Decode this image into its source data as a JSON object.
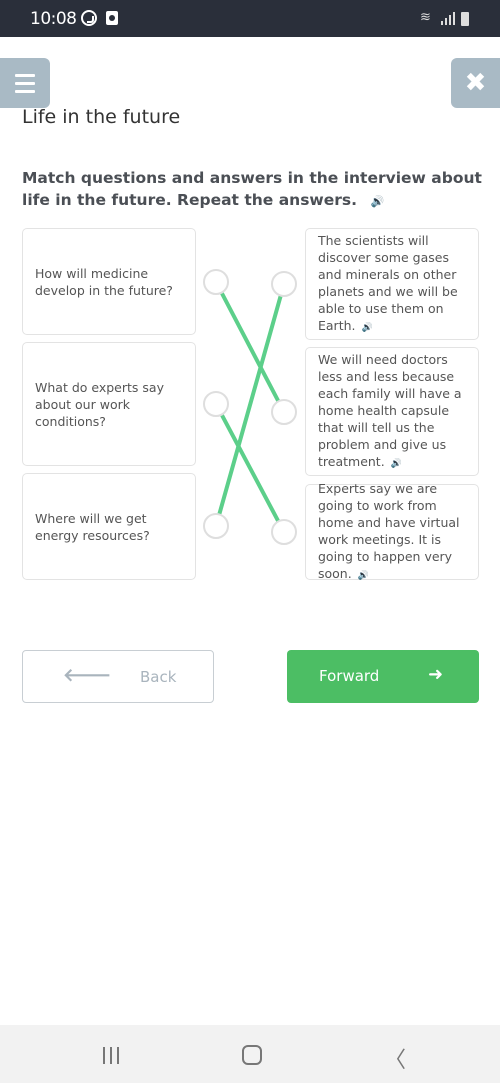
{
  "status_bar": {
    "time": "10:08",
    "icons": [
      "whatsapp-icon",
      "camera-notification-icon",
      "wifi-icon",
      "signal-icon",
      "battery-icon"
    ]
  },
  "header": {
    "menu_icon": "hamburger-menu-icon",
    "close_icon": "close-icon",
    "close_glyph": "✖",
    "title": "Life in the future"
  },
  "exercise": {
    "instruction": "Match questions and answers in the interview about life in the future. Repeat the answers.",
    "speaker_glyph": "🔊",
    "questions": [
      {
        "text": "How will medicine develop in the future?"
      },
      {
        "text": "What do experts say about our work conditions?"
      },
      {
        "text": "Where will we get energy resources?"
      }
    ],
    "answers": [
      {
        "text": "The scientists will discover some gases and minerals on other planets and we will be able to use them on Earth."
      },
      {
        "text": "We will need doctors less and less because each family will have a home health capsule that will tell us the problem and give us treatment."
      },
      {
        "text": "Experts say we are going to work from home and have virtual work meetings. It is going to happen very soon."
      }
    ],
    "connections": [
      {
        "question": 0,
        "answer": 1
      },
      {
        "question": 1,
        "answer": 2
      },
      {
        "question": 2,
        "answer": 0
      }
    ],
    "line_color": "#5ccf8a"
  },
  "navigation": {
    "back_label": "Back",
    "back_arrow": "🡐",
    "forward_label": "Forward",
    "forward_arrow": "➜"
  },
  "system_nav": {
    "recents": "recents-icon",
    "home": "home-icon",
    "back_glyph": "〈"
  }
}
